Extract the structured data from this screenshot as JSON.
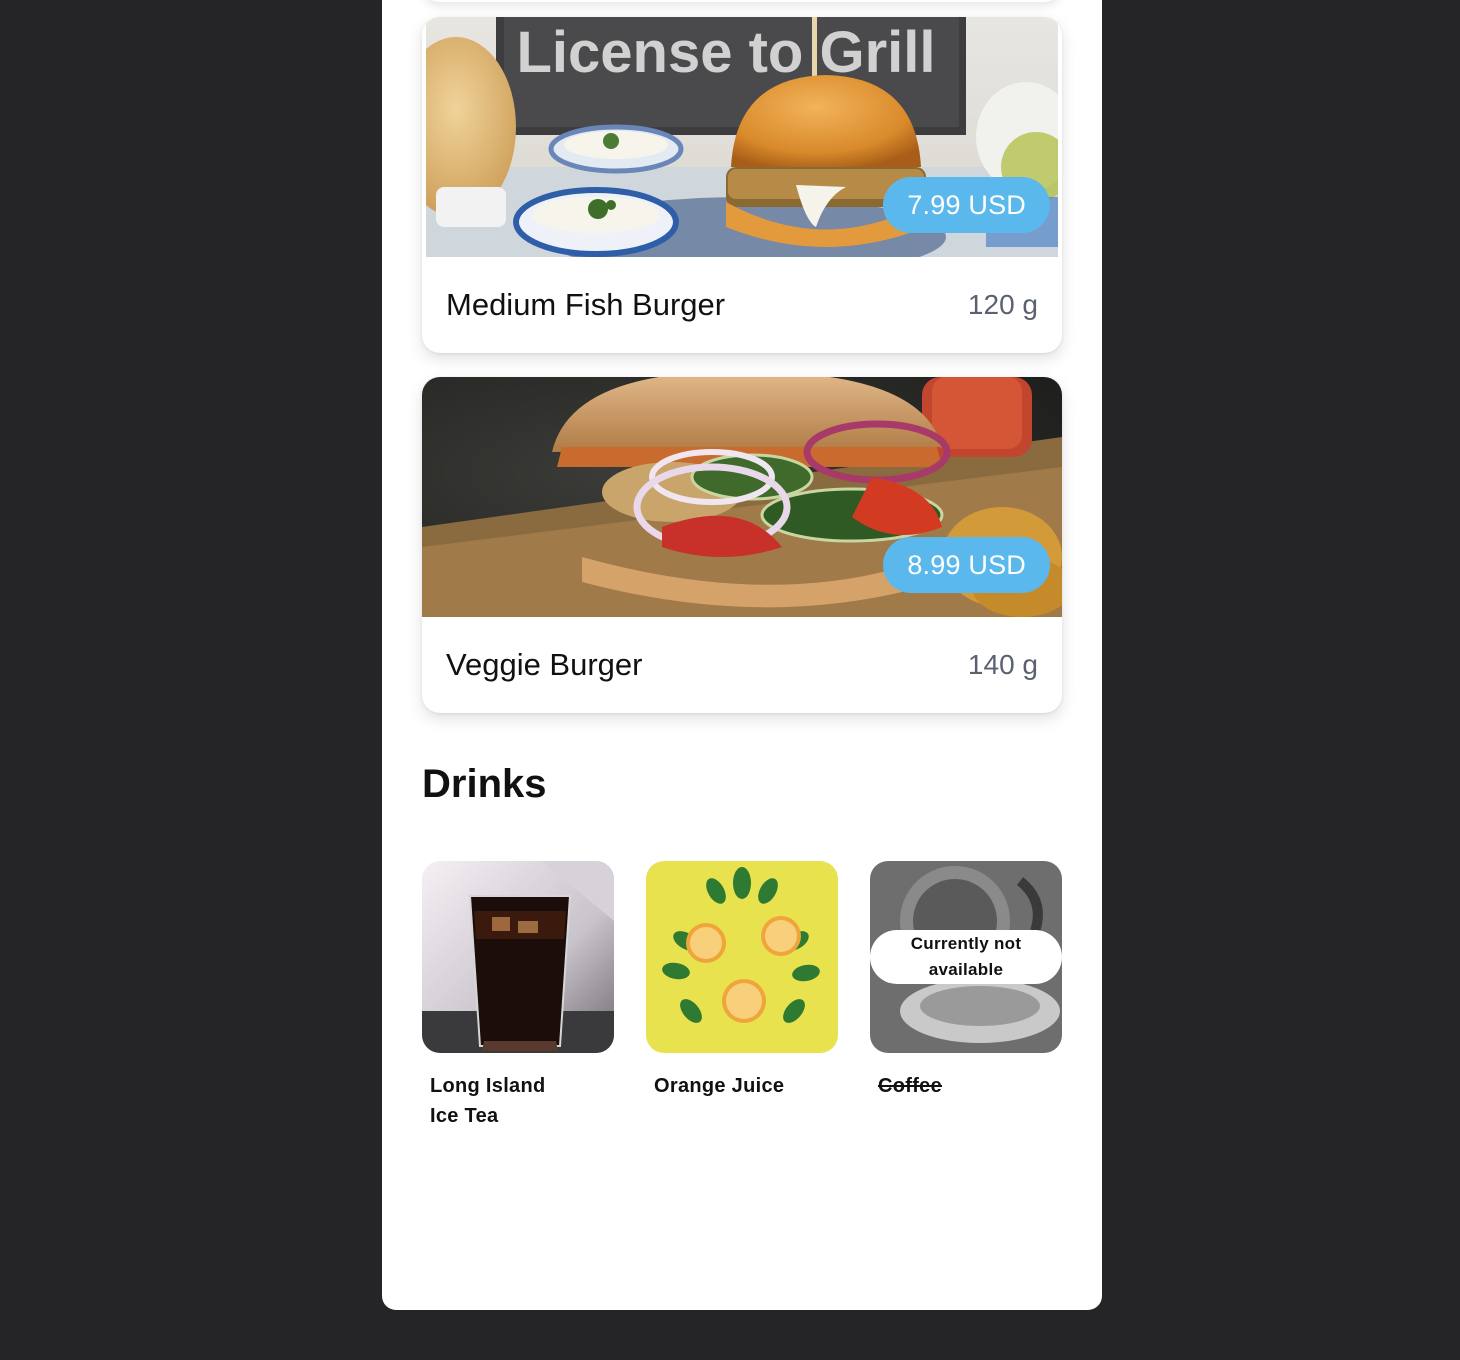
{
  "menu_items": [
    {
      "name": "Medium Fish Burger",
      "weight": "120 g",
      "price": "7.99 USD",
      "sign_text": "License to Grill"
    },
    {
      "name": "Veggie Burger",
      "weight": "140 g",
      "price": "8.99 USD"
    }
  ],
  "drinks_section": {
    "title": "Drinks",
    "items": [
      {
        "name": "Long Island Ice Tea",
        "available": true
      },
      {
        "name": "Orange Juice",
        "available": true
      },
      {
        "name": "Coffee",
        "available": false,
        "status": "Currently not available"
      }
    ]
  },
  "colors": {
    "background": "#252527",
    "card": "#ffffff",
    "price_badge": "#5bb8ec",
    "weight_text": "#5a6170"
  }
}
